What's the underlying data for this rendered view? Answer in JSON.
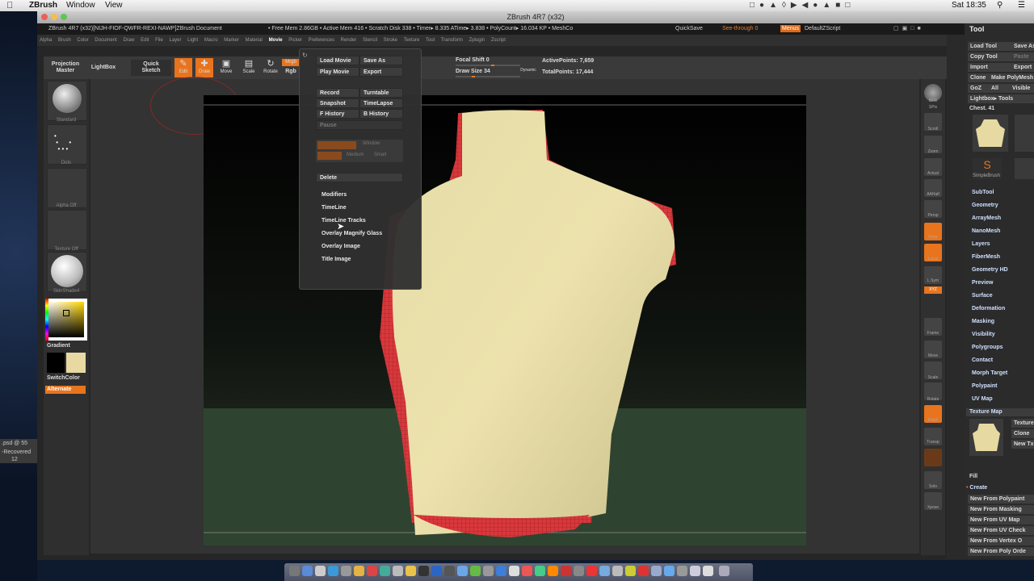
{
  "menubar": {
    "app": "ZBrush",
    "window": "Window",
    "view": "View",
    "clock": "Sat 18:35"
  },
  "window": {
    "title": "ZBrush 4R7 (x32)"
  },
  "infobar": {
    "doc": "ZBrush 4R7 (x32)[NIJH-FIOF-QWFR-REXI-NAWP]ZBrush Document",
    "stats": "• Free Mem 2.86GB • Active Mem 416 • Scratch Disk 338 • Timer▸ 8.335 ATime▸ 3.838 • PolyCount▸ 16.034 KP • MeshCo",
    "quicksave": "QuickSave",
    "seethrough": "See-through 0",
    "menus": "Menus",
    "script": "DefaultZScript"
  },
  "zmenus": [
    "Alpha",
    "Brush",
    "Color",
    "Document",
    "Draw",
    "Edit",
    "File",
    "Layer",
    "Light",
    "Macro",
    "Marker",
    "Material",
    "Movie",
    "Picker",
    "Preferences",
    "Render",
    "Stencil",
    "Stroke",
    "Texture",
    "Tool",
    "Transform",
    "Zplugin",
    "Zscript"
  ],
  "toolbar": {
    "projection": "Projection",
    "master": "Master",
    "lightbox": "LightBox",
    "quick": "Quick",
    "sketch": "Sketch",
    "edit": "Edit",
    "draw": "Draw",
    "move": "Move",
    "scale": "Scale",
    "rotate": "Rotate",
    "mrgb": "Mrgb",
    "rgb": "Rgb",
    "focal": "Focal Shift 0",
    "drawsize": "Draw Size 34",
    "dynamic": "Dynamic",
    "activepoints": "ActivePoints: 7,659",
    "totalpoints": "TotalPoints: 17,444"
  },
  "leftshelf": {
    "standard": "Standard",
    "dots": "Dots",
    "alpha": "Alpha Off",
    "texture": "Texture Off",
    "material": "SkinShade4",
    "gradient": "Gradient",
    "switchcolor": "SwitchColor",
    "alternate": "Alternate"
  },
  "moviemenu": {
    "load": "Load Movie",
    "saveas": "Save As",
    "play": "Play Movie",
    "export": "Export",
    "record": "Record",
    "turntable": "Turntable",
    "snapshot": "Snapshot",
    "timelapse": "TimeLapse",
    "fhistory": "F History",
    "bhistory": "B History",
    "pause": "Pause",
    "window": "Window",
    "medium": "Medium",
    "small": "Small",
    "delete": "Delete",
    "items": [
      "Modifiers",
      "TimeLine",
      "TimeLine Tracks",
      "Overlay Magnify Glass",
      "Overlay Image",
      "Title Image"
    ]
  },
  "rightshelf": [
    "BPR",
    "SPix",
    "Scroll",
    "Zoom",
    "Actual",
    "AAHalf",
    "Persp",
    "Floor",
    "Local",
    "L.Sym",
    "XYZ",
    "Frame",
    "Move",
    "Scale",
    "Rotate",
    "PolyF",
    "Transp",
    "Solo",
    "Xpose"
  ],
  "tooltray": {
    "title": "Tool",
    "loadtool": "Load Tool",
    "saveas": "Save As",
    "copytool": "Copy Tool",
    "paste": "Paste",
    "import": "Import",
    "export": "Export",
    "clone": "Clone",
    "make": "Make PolyMesh",
    "goz": "GoZ",
    "all": "All",
    "visible": "Visible",
    "lightbox": "Lightbox▸ Tools",
    "chest": "Chest. 41",
    "simplebrush": "SimpleBrush",
    "subpalettes": [
      "SubTool",
      "Geometry",
      "ArrayMesh",
      "NanoMesh",
      "Layers",
      "FiberMesh",
      "Geometry HD",
      "Preview",
      "Surface",
      "Deformation",
      "Masking",
      "Visibility",
      "Polygroups",
      "Contact",
      "Morph Target",
      "Polypaint",
      "UV Map"
    ],
    "texturemap": "Texture Map",
    "texture": "Texture",
    "clone2": "Clone",
    "newtx": "New Tx",
    "fill": "Fill",
    "create": "Create",
    "newitems": [
      "New From Polypaint",
      "New From Masking",
      "New From UV Map",
      "New From UV Check",
      "New From Vertex O",
      "New From Poly Orde"
    ]
  },
  "desktop": {
    "file": ".psd @ 55",
    "recovered": "-Recovered",
    "num": "12"
  }
}
